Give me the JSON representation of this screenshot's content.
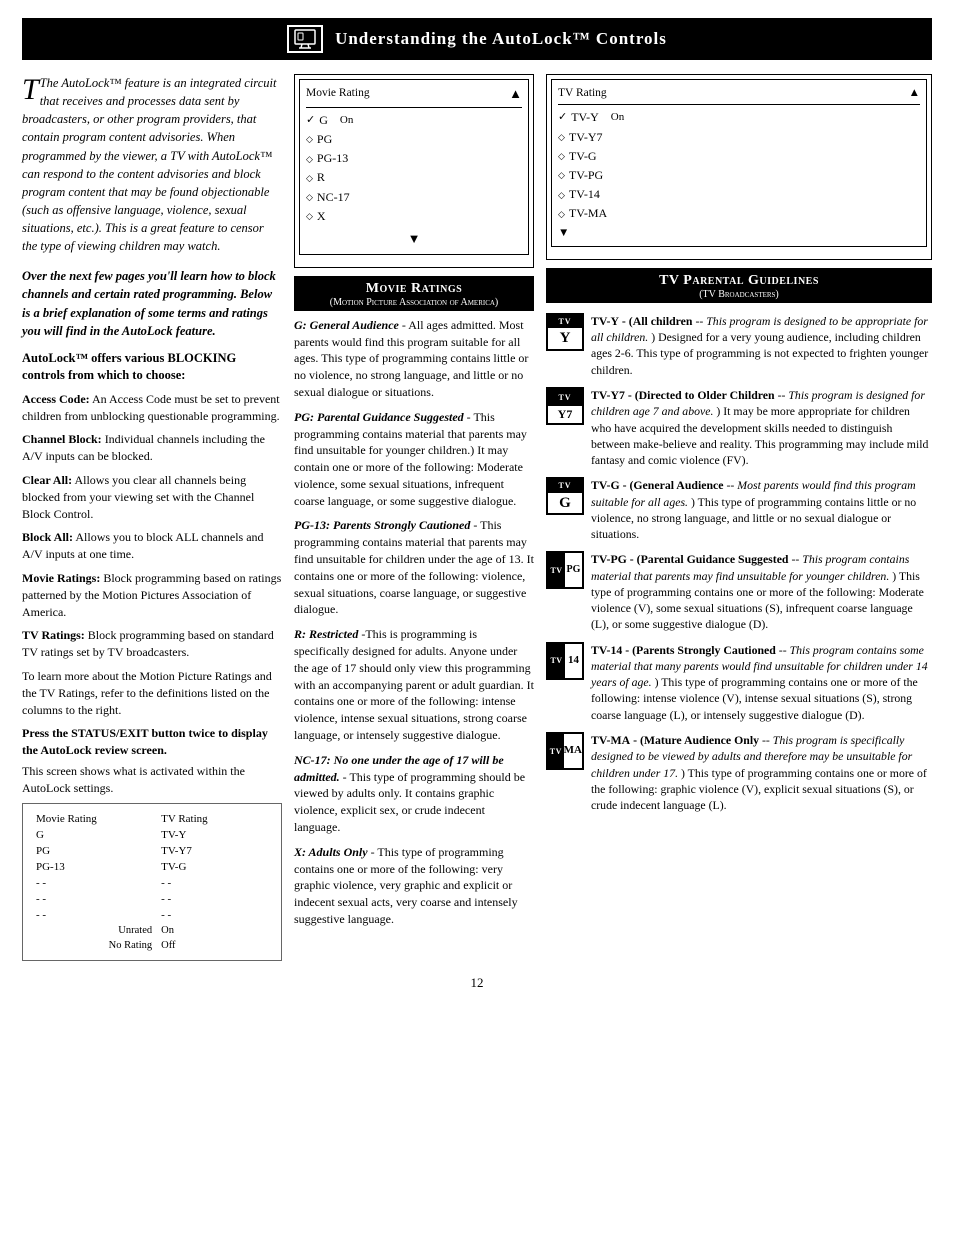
{
  "header": {
    "title": "Understanding the AutoLock™ Controls"
  },
  "left_column": {
    "intro": "The AutoLock™ feature is an integrated circuit that receives and processes data sent by broadcasters, or other program providers, that contain program content advisories. When programmed by the viewer, a TV with AutoLock™ can respond to the content advisories and block program content that may be found objectionable (such as offensive language, violence, sexual situations, etc.). This is a great feature to censor the type of viewing children may watch.",
    "bold_para": "Over the next few pages you'll learn how to block channels and certain rated programming. Below is a brief explanation of some terms and ratings you will find in the AutoLock feature.",
    "blocking_heading": "AutoLock™ offers various BLOCKING controls from which to choose:",
    "terms": [
      {
        "term": "Access Code:",
        "desc": " An Access Code must be set to prevent children from unblocking questionable programming."
      },
      {
        "term": "Channel Block:",
        "desc": " Individual channels including the A/V inputs can be blocked."
      },
      {
        "term": "Clear All:",
        "desc": " Allows you clear all channels being blocked from your viewing set with the Channel Block Control."
      },
      {
        "term": "Block All:",
        "desc": " Allows you to block ALL channels and A/V inputs at one time."
      },
      {
        "term": "Movie Ratings:",
        "desc": " Block programming based on ratings patterned by the Motion Pictures Association of America."
      },
      {
        "term": "TV Ratings:",
        "desc": " Block programming based on standard TV ratings set by TV broadcasters."
      }
    ],
    "bottom_text": "To learn more about the Motion Picture Ratings and the TV Ratings, refer to the definitions listed on the columns to the right.",
    "press_heading": "Press the STATUS/EXIT button twice to display the AutoLock review screen.",
    "screen_intro": "This screen shows what is activated within the AutoLock settings.",
    "small_screen": {
      "col1_header": "Movie Rating",
      "col2_header": "TV Rating",
      "rows": [
        [
          "G",
          "TV-Y"
        ],
        [
          "PG",
          "TV-Y7"
        ],
        [
          "PG-13",
          "TV-G"
        ],
        [
          "- -",
          "- -"
        ],
        [
          "- -",
          "- -"
        ],
        [
          "- -",
          "- -"
        ]
      ],
      "footer_row1_label": "Unrated",
      "footer_row1_val": "On",
      "footer_row2_label": "No Rating",
      "footer_row2_val": "Off"
    }
  },
  "middle_column": {
    "movie_box": {
      "header": "Movie Rating",
      "on_label": "On",
      "checked": "G",
      "items": [
        "G",
        "PG",
        "PG-13",
        "R",
        "NC-17",
        "X"
      ]
    },
    "section_header": "Movie Ratings",
    "section_subheader": "(Motion Picture Association of America)",
    "ratings": [
      {
        "id": "G",
        "title": "G: General Audience",
        "text": " - All ages admitted. Most parents would find this program suitable for all ages. This type of programming contains little or no violence, no strong language, and little or no sexual dialogue or situations."
      },
      {
        "id": "PG",
        "title": "PG: Parental Guidance Suggested",
        "text": " - This programming contains material that parents may find unsuitable for younger children.) It may contain one or more of the following: Moderate violence, some sexual situations, infrequent coarse language, or some suggestive dialogue."
      },
      {
        "id": "PG-13",
        "title": "PG-13: Parents Strongly Cautioned",
        "text": " - This programming contains material that parents may find unsuitable for children under the age of 13. It contains one or more of the following: violence, sexual situations, coarse language, or suggestive dialogue."
      },
      {
        "id": "R",
        "title": "R: Restricted",
        "text": " -This is programming is specifically designed for adults. Anyone under the age of 17 should only view this programming with an accompanying parent or adult guardian. It contains one or more of the following: intense violence, intense sexual situations, strong coarse language, or intensely suggestive dialogue."
      },
      {
        "id": "NC-17",
        "title": "NC-17: No one under the age of 17 will be admitted.",
        "text": " - This type of programming should be viewed by adults only. It contains graphic violence, explicit sex, or crude indecent language."
      },
      {
        "id": "X",
        "title": "X: Adults Only",
        "text": " - This type of programming contains one or more of the following: very graphic violence, very graphic and explicit or indecent sexual acts, very coarse and intensely suggestive language."
      }
    ]
  },
  "right_column": {
    "tv_box": {
      "header": "TV Rating",
      "on_label": "On",
      "checked": "TV-Y",
      "items": [
        "TV-Y",
        "TV-Y7",
        "TV-G",
        "TV-PG",
        "TV-14",
        "TV-MA"
      ]
    },
    "section_header": "TV Parental Guidelines",
    "section_subheader": "(TV Broadcasters)",
    "ratings": [
      {
        "id": "TV-Y",
        "badge_top": "TV",
        "badge_bottom": "Y",
        "title": "TV-Y",
        "bold_desc": " - (All children",
        "italic_desc": " -- This program is designed to be appropriate for all children.",
        "text": ") Designed for a very young audience, including children ages 2-6. This type of programming is not expected to frighten younger children."
      },
      {
        "id": "TV-Y7",
        "badge_top": "TV",
        "badge_bottom": "Y7",
        "title": "TV-Y7",
        "bold_desc": " - (Directed to Older Children",
        "italic_desc": " -- This program is designed for children age 7 and above.",
        "text": ") It may be more appropriate for children who have acquired the development skills needed to distinguish between make-believe and reality. This programming may include mild fantasy and comic violence (FV)."
      },
      {
        "id": "TV-G",
        "badge_top": "TV",
        "badge_bottom": "G",
        "title": "TV-G",
        "bold_desc": " - (General Audience",
        "italic_desc": " -- Most parents would find this program suitable for all ages.",
        "text": ") This type of programming contains little or no violence, no strong language, and little or no sexual dialogue or situations."
      },
      {
        "id": "TV-PG",
        "badge_top": "TV",
        "badge_bottom": "PG",
        "title": "TV-PG",
        "bold_desc": " - (Parental Guidance Suggested",
        "italic_desc": " -- This program contains material that parents may find unsuitable for younger children.",
        "text": ") This type of programming contains one or more of the following: Moderate violence (V), some sexual situations (S), infrequent coarse language (L), or some suggestive dialogue (D)."
      },
      {
        "id": "TV-14",
        "badge_top": "TV",
        "badge_bottom": "14",
        "title": "TV-14",
        "bold_desc": " - (Parents Strongly Cautioned",
        "italic_desc": " -- This program contains some material that many parents would find unsuitable for children under 14 years of age.",
        "text": ") This type of programming contains one or more of the following: intense violence (V), intense sexual situations (S), strong coarse language (L), or intensely suggestive dialogue (D)."
      },
      {
        "id": "TV-MA",
        "badge_top": "TV",
        "badge_bottom": "MA",
        "title": "TV-MA",
        "bold_desc": " - (Mature Audience Only",
        "italic_desc": " -- This program is specifically designed to be viewed by adults and therefore may be unsuitable for children under 17.",
        "text": ") This type of programming contains one or more of the following: graphic violence (V), explicit sexual situations (S), or crude indecent language (L)."
      }
    ]
  },
  "page_number": "12"
}
